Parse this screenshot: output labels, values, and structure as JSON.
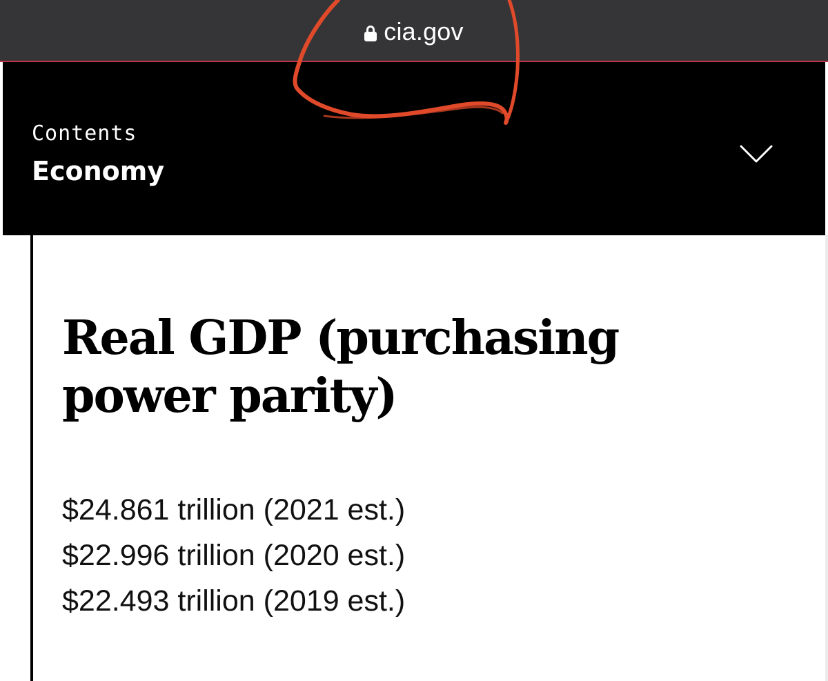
{
  "browser": {
    "url": "cia.gov",
    "lock_icon": "lock-icon"
  },
  "header": {
    "contents_label": "Contents",
    "section_title": "Economy",
    "toggle_icon": "chevron-down-icon"
  },
  "main": {
    "field_title": "Real GDP (purchasing power parity)",
    "values": [
      "$24.861 trillion (2021 est.)",
      "$22.996 trillion (2020 est.)",
      "$22.493 trillion (2019 est.)"
    ]
  },
  "colors": {
    "url_bar": "#353537",
    "header_bg": "#000000",
    "annotation": "#e04a2a"
  }
}
